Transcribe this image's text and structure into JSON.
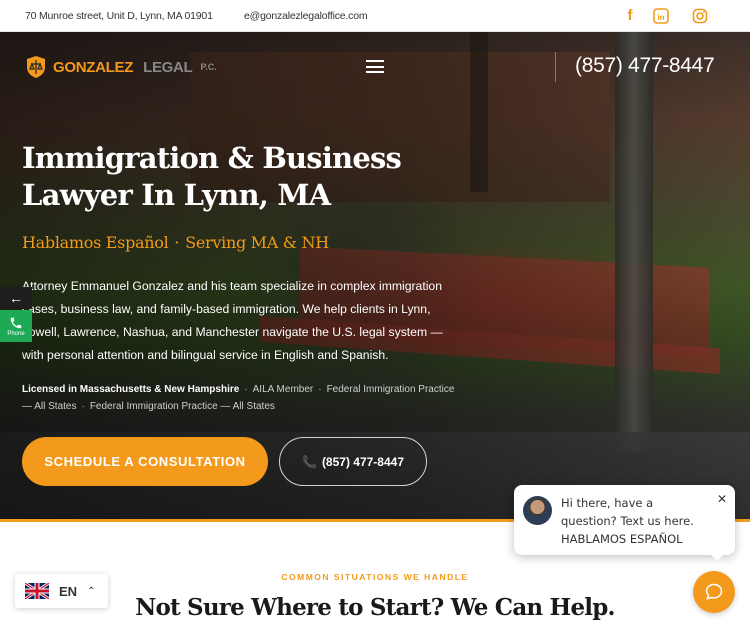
{
  "topbar": {
    "address": "70 Munroe street, Unit D, Lynn, MA 01901",
    "email": "e@gonzalezlegaloffice.com",
    "social": [
      {
        "icon": "facebook-icon"
      },
      {
        "icon": "linkedin-icon"
      },
      {
        "icon": "instagram-icon"
      }
    ]
  },
  "header": {
    "logo_name": "GONZALEZ",
    "logo_legal": "LEGAL",
    "logo_pc": "P.C.",
    "phone": "(857) 477-8447"
  },
  "hero": {
    "title": "Immigration & Business Lawyer In Lynn, MA",
    "tagline_1": "Hablamos Español",
    "tagline_sep": "·",
    "tagline_2": "Serving MA & NH",
    "description": "Attorney Emmanuel Gonzalez and his team specialize in complex immigration cases, business law, and family-based immigration. We help clients in Lynn, Lowell, Lawrence, Nashua, and Manchester navigate the U.S. legal system — with personal attention and bilingual service in English and Spanish.",
    "credentials": [
      "Licensed in Massachusetts & New Hampshire",
      "AILA Member",
      "Federal Immigration Practice — All States",
      "Federal Immigration Practice — All States"
    ],
    "cta_primary": "SCHEDULE A CONSULTATION",
    "cta_secondary": "(857) 477-8447"
  },
  "side": {
    "phone_label": "Phone"
  },
  "chat": {
    "line1": "Hi there, have a",
    "line2": "question? Text us here.",
    "line3": "HABLAMOS ESPAÑOL"
  },
  "section": {
    "kicker": "COMMON SITUATIONS WE HANDLE",
    "title": "Not Sure Where to Start? We Can Help."
  },
  "language": {
    "code": "EN"
  },
  "colors": {
    "accent": "#f39a1c",
    "phone_green": "#1eaa55"
  }
}
